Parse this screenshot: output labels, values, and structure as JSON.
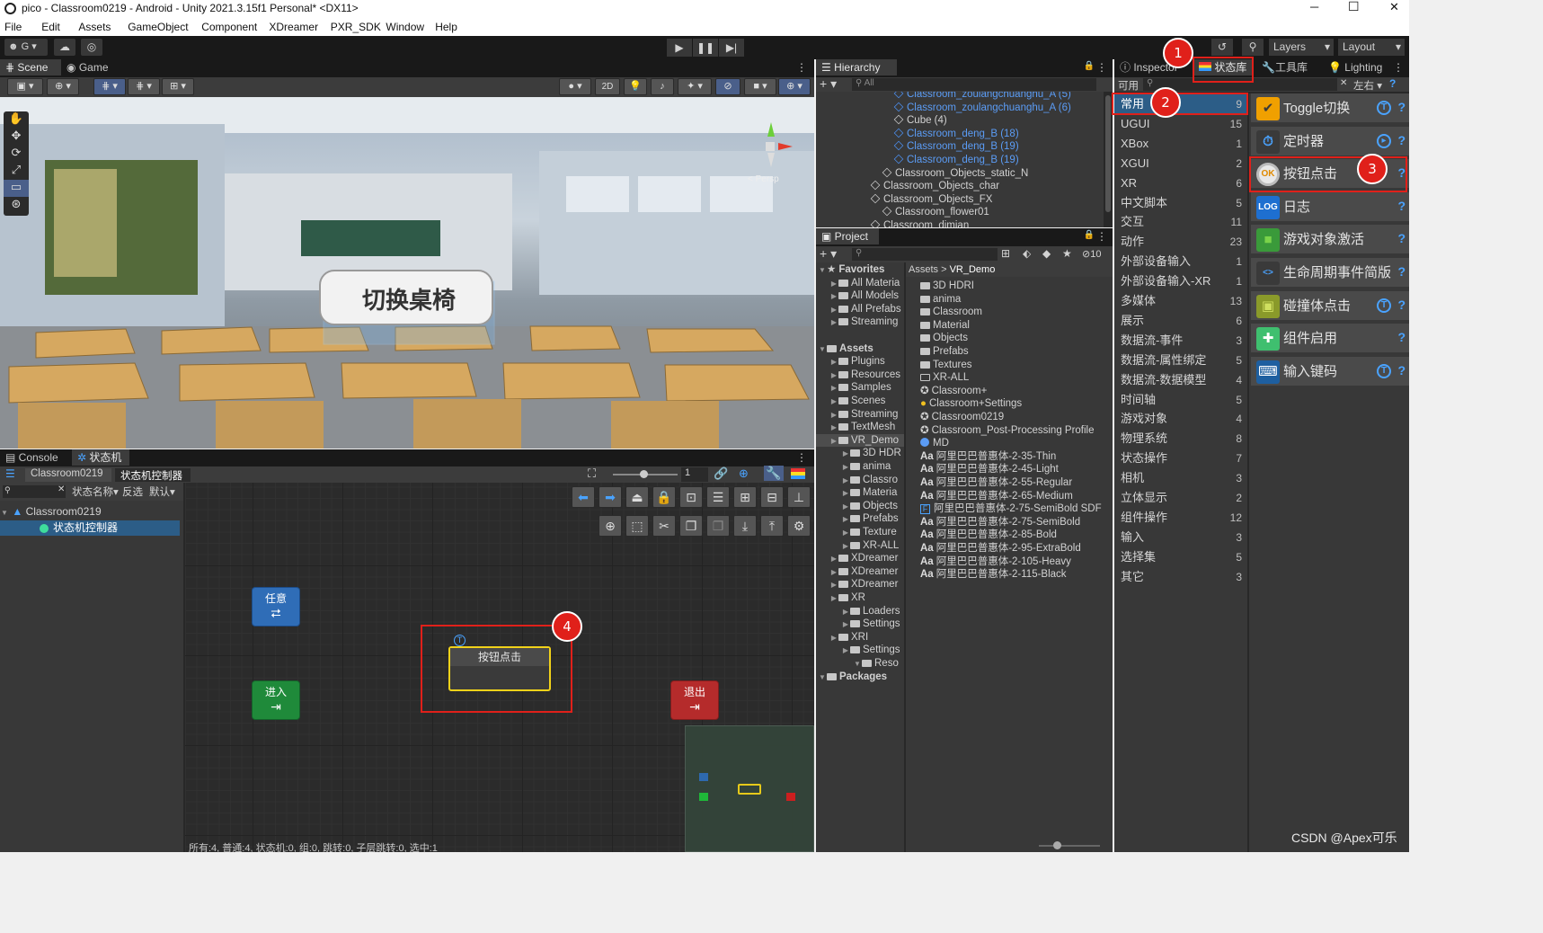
{
  "window": {
    "title": "pico - Classroom0219 - Android - Unity 2021.3.15f1 Personal* <DX11>",
    "minimize": "─",
    "maximize": "☐",
    "close": "✕"
  },
  "menu": [
    "File",
    "Edit",
    "Assets",
    "GameObject",
    "Component",
    "XDreamer",
    "PXR_SDK",
    "Window",
    "Help"
  ],
  "toolbar": {
    "account": "G",
    "layers": "Layers",
    "layout": "Layout"
  },
  "scene": {
    "tab_scene": "Scene",
    "tab_game": "Game",
    "btn_2d": "2D",
    "sign_text": "切换桌椅",
    "persp": "< Persp"
  },
  "hierarchy": {
    "tab": "Hierarchy",
    "search": "All",
    "rows": [
      {
        "text": "Classroom_zoulangchuanghu_A (5)",
        "blue": true,
        "indent": 7
      },
      {
        "text": "Classroom_zoulangchuanghu_A (6)",
        "blue": true,
        "indent": 7
      },
      {
        "text": "Cube (4)",
        "blue": false,
        "indent": 7
      },
      {
        "text": "Classroom_deng_B (18)",
        "blue": true,
        "indent": 7
      },
      {
        "text": "Classroom_deng_B (19)",
        "blue": true,
        "indent": 7
      },
      {
        "text": "Classroom_deng_B (19)",
        "blue": true,
        "indent": 7
      },
      {
        "text": "Classroom_Objects_static_N",
        "blue": false,
        "indent": 6
      },
      {
        "text": "Classroom_Objects_char",
        "blue": false,
        "indent": 5
      },
      {
        "text": "Classroom_Objects_FX",
        "blue": false,
        "indent": 5
      },
      {
        "text": "Classroom_flower01",
        "blue": false,
        "indent": 6
      },
      {
        "text": "Classroom_dimian",
        "blue": false,
        "indent": 5
      }
    ]
  },
  "project": {
    "tab": "Project",
    "count": "10",
    "breadcrumb": [
      "Assets",
      "VR_Demo"
    ],
    "tree": [
      {
        "t": "Favorites",
        "b": true,
        "i": 0,
        "star": true
      },
      {
        "t": "All Materia",
        "i": 1
      },
      {
        "t": "All Models",
        "i": 1
      },
      {
        "t": "All Prefabs",
        "i": 1
      },
      {
        "t": "Streaming",
        "i": 1
      },
      {
        "t": "",
        "i": 0
      },
      {
        "t": "Assets",
        "b": true,
        "i": 0
      },
      {
        "t": "Plugins",
        "i": 1
      },
      {
        "t": "Resources",
        "i": 1
      },
      {
        "t": "Samples",
        "i": 1
      },
      {
        "t": "Scenes",
        "i": 1
      },
      {
        "t": "Streaming",
        "i": 1
      },
      {
        "t": "TextMesh",
        "i": 1
      },
      {
        "t": "VR_Demo",
        "i": 1,
        "sel": true
      },
      {
        "t": "3D HDR",
        "i": 2
      },
      {
        "t": "anima",
        "i": 2
      },
      {
        "t": "Classro",
        "i": 2
      },
      {
        "t": "Materia",
        "i": 2
      },
      {
        "t": "Objects",
        "i": 2
      },
      {
        "t": "Prefabs",
        "i": 2
      },
      {
        "t": "Texture",
        "i": 2
      },
      {
        "t": "XR-ALL",
        "i": 2
      },
      {
        "t": "XDreamer",
        "i": 1
      },
      {
        "t": "XDreamer",
        "i": 1
      },
      {
        "t": "XDreamer",
        "i": 1
      },
      {
        "t": "XR",
        "i": 1
      },
      {
        "t": "Loaders",
        "i": 2
      },
      {
        "t": "Settings",
        "i": 2
      },
      {
        "t": "XRI",
        "i": 1
      },
      {
        "t": "Settings",
        "i": 2
      },
      {
        "t": "Reso",
        "i": 3
      },
      {
        "t": "Packages",
        "b": true,
        "i": 0
      }
    ],
    "files": [
      {
        "t": "3D HDRI",
        "k": "folder"
      },
      {
        "t": "anima",
        "k": "folder"
      },
      {
        "t": "Classroom",
        "k": "folder"
      },
      {
        "t": "Material",
        "k": "folder"
      },
      {
        "t": "Objects",
        "k": "folder"
      },
      {
        "t": "Prefabs",
        "k": "folder"
      },
      {
        "t": "Textures",
        "k": "folder"
      },
      {
        "t": "XR-ALL",
        "k": "folder-empty"
      },
      {
        "t": "Classroom+",
        "k": "unity"
      },
      {
        "t": "Classroom+Settings",
        "k": "settings"
      },
      {
        "t": "Classroom0219",
        "k": "unity"
      },
      {
        "t": "Classroom_Post-Processing Profile",
        "k": "unity"
      },
      {
        "t": "MD",
        "k": "md"
      },
      {
        "t": "阿里巴巴普惠体-2-35-Thin",
        "k": "font"
      },
      {
        "t": "阿里巴巴普惠体-2-45-Light",
        "k": "font"
      },
      {
        "t": "阿里巴巴普惠体-2-55-Regular",
        "k": "font"
      },
      {
        "t": "阿里巴巴普惠体-2-65-Medium",
        "k": "font"
      },
      {
        "t": "阿里巴巴普惠体-2-75-SemiBold SDF",
        "k": "sdf"
      },
      {
        "t": "阿里巴巴普惠体-2-75-SemiBold",
        "k": "font"
      },
      {
        "t": "阿里巴巴普惠体-2-85-Bold",
        "k": "font"
      },
      {
        "t": "阿里巴巴普惠体-2-95-ExtraBold",
        "k": "font"
      },
      {
        "t": "阿里巴巴普惠体-2-105-Heavy",
        "k": "font"
      },
      {
        "t": "阿里巴巴普惠体-2-115-Black",
        "k": "font"
      }
    ]
  },
  "inspector": {
    "tab_inspector": "Inspector",
    "tab_statelib": "状态库",
    "tab_toolbox": "工具库",
    "tab_lighting": "Lighting",
    "filter_label": "可用",
    "layout_label": "左右",
    "categories": [
      {
        "name": "常用",
        "count": "9"
      },
      {
        "name": "UGUI",
        "count": "15"
      },
      {
        "name": "XBox",
        "count": "1"
      },
      {
        "name": "XGUI",
        "count": "2"
      },
      {
        "name": "XR",
        "count": "6"
      },
      {
        "name": "中文脚本",
        "count": "5"
      },
      {
        "name": "交互",
        "count": "11"
      },
      {
        "name": "动作",
        "count": "23"
      },
      {
        "name": "外部设备输入",
        "count": "1"
      },
      {
        "name": "外部设备输入-XR",
        "count": "1"
      },
      {
        "name": "多媒体",
        "count": "13"
      },
      {
        "name": "展示",
        "count": "6"
      },
      {
        "name": "数据流-事件",
        "count": "3"
      },
      {
        "name": "数据流-属性绑定",
        "count": "5"
      },
      {
        "name": "数据流-数据模型",
        "count": "4"
      },
      {
        "name": "时间轴",
        "count": "5"
      },
      {
        "name": "游戏对象",
        "count": "4"
      },
      {
        "name": "物理系统",
        "count": "8"
      },
      {
        "name": "状态操作",
        "count": "7"
      },
      {
        "name": "相机",
        "count": "3"
      },
      {
        "name": "立体显示",
        "count": "2"
      },
      {
        "name": "组件操作",
        "count": "12"
      },
      {
        "name": "输入",
        "count": "3"
      },
      {
        "name": "选择集",
        "count": "5"
      },
      {
        "name": "其它",
        "count": "3"
      }
    ],
    "actions": [
      {
        "name": "Toggle切换",
        "icon": "toggle-icon",
        "t": true
      },
      {
        "name": "定时器",
        "icon": "timer-icon",
        "play": true
      },
      {
        "name": "按钮点击",
        "icon": "ok-button-icon",
        "t": false
      },
      {
        "name": "日志",
        "icon": "log-icon"
      },
      {
        "name": "游戏对象激活",
        "icon": "cube-icon"
      },
      {
        "name": "生命周期事件简版",
        "icon": "code-icon"
      },
      {
        "name": "碰撞体点击",
        "icon": "collider-icon",
        "t": true
      },
      {
        "name": "组件启用",
        "icon": "puzzle-icon"
      },
      {
        "name": "输入键码",
        "icon": "keyboard-icon",
        "t": true
      }
    ]
  },
  "console": {
    "tab_console": "Console",
    "tab_statemachine": "状态机"
  },
  "statemachine": {
    "bc_root": "Classroom0219",
    "bc_child": "状态机控制器",
    "zoom": "1",
    "filter_name": "状态名称",
    "filter_invert": "反选",
    "filter_default": "默认",
    "tree_root": "Classroom0219",
    "tree_child": "状态机控制器",
    "nodes": {
      "any": "任意",
      "enter": "进入",
      "exit": "退出",
      "button": "按钮点击"
    },
    "status": "所有:4, 普通:4, 状态机:0, 组:0, 跳转:0, 子层跳转:0, 选中:1"
  },
  "markers": [
    "1",
    "2",
    "3",
    "4"
  ],
  "watermark": "CSDN @Apex可乐"
}
